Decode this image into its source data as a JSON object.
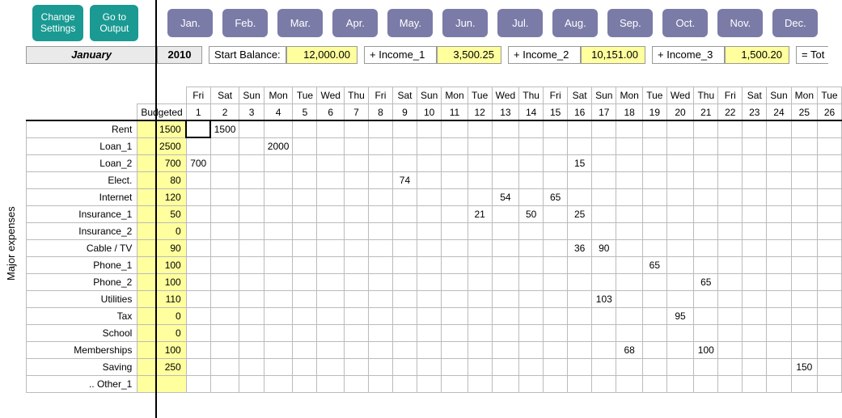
{
  "buttons": {
    "change_settings": "Change\nSettings",
    "goto_output": "Go to\nOutput"
  },
  "months_short": [
    "Jan.",
    "Feb.",
    "Mar.",
    "Apr.",
    "May.",
    "Jun.",
    "Jul.",
    "Aug.",
    "Sep.",
    "Oct.",
    "Nov.",
    "Dec."
  ],
  "info": {
    "month": "January",
    "year": "2010",
    "start_balance_label": "Start Balance:",
    "start_balance": "12,000.00",
    "income1_label": "+ Income_1",
    "income1": "3,500.25",
    "income2_label": "+ Income_2",
    "income2": "10,151.00",
    "income3_label": "+ Income_3",
    "income3": "1,500.20",
    "total_label": "= Tot"
  },
  "side_label": "Major expenses",
  "budgeted_label": "Budgeted",
  "dow": [
    "Fri",
    "Sat",
    "Sun",
    "Mon",
    "Tue",
    "Wed",
    "Thu",
    "Fri",
    "Sat",
    "Sun",
    "Mon",
    "Tue",
    "Wed",
    "Thu",
    "Fri",
    "Sat",
    "Sun",
    "Mon",
    "Tue",
    "Wed",
    "Thu",
    "Fri",
    "Sat",
    "Sun",
    "Mon",
    "Tue"
  ],
  "daynum": [
    "1",
    "2",
    "3",
    "4",
    "5",
    "6",
    "7",
    "8",
    "9",
    "10",
    "11",
    "12",
    "13",
    "14",
    "15",
    "16",
    "17",
    "18",
    "19",
    "20",
    "21",
    "22",
    "23",
    "24",
    "25",
    "26"
  ],
  "rows": [
    {
      "label": "Rent",
      "budget": "1500",
      "cells": {
        "2": "1500"
      }
    },
    {
      "label": "Loan_1",
      "budget": "2500",
      "cells": {
        "4": "2000"
      }
    },
    {
      "label": "Loan_2",
      "budget": "700",
      "cells": {
        "1": "700",
        "16": "15"
      }
    },
    {
      "label": "Elect.",
      "budget": "80",
      "cells": {
        "9": "74"
      }
    },
    {
      "label": "Internet",
      "budget": "120",
      "cells": {
        "13": "54",
        "15": "65"
      }
    },
    {
      "label": "Insurance_1",
      "budget": "50",
      "cells": {
        "12": "21",
        "14": "50",
        "16": "25"
      }
    },
    {
      "label": "Insurance_2",
      "budget": "0",
      "cells": {}
    },
    {
      "label": "Cable / TV",
      "budget": "90",
      "cells": {
        "16": "36",
        "17": "90"
      }
    },
    {
      "label": "Phone_1",
      "budget": "100",
      "cells": {
        "19": "65"
      }
    },
    {
      "label": "Phone_2",
      "budget": "100",
      "cells": {
        "21": "65"
      }
    },
    {
      "label": "Utilities",
      "budget": "110",
      "cells": {
        "17": "103"
      }
    },
    {
      "label": "Tax",
      "budget": "0",
      "cells": {
        "20": "95"
      }
    },
    {
      "label": "School",
      "budget": "0",
      "cells": {}
    },
    {
      "label": "Memberships",
      "budget": "100",
      "cells": {
        "18": "68",
        "21": "100"
      }
    },
    {
      "label": "Saving",
      "budget": "250",
      "cells": {
        "25": "150"
      }
    },
    {
      "label": ".. Other_1",
      "budget": "",
      "cells": {}
    }
  ]
}
